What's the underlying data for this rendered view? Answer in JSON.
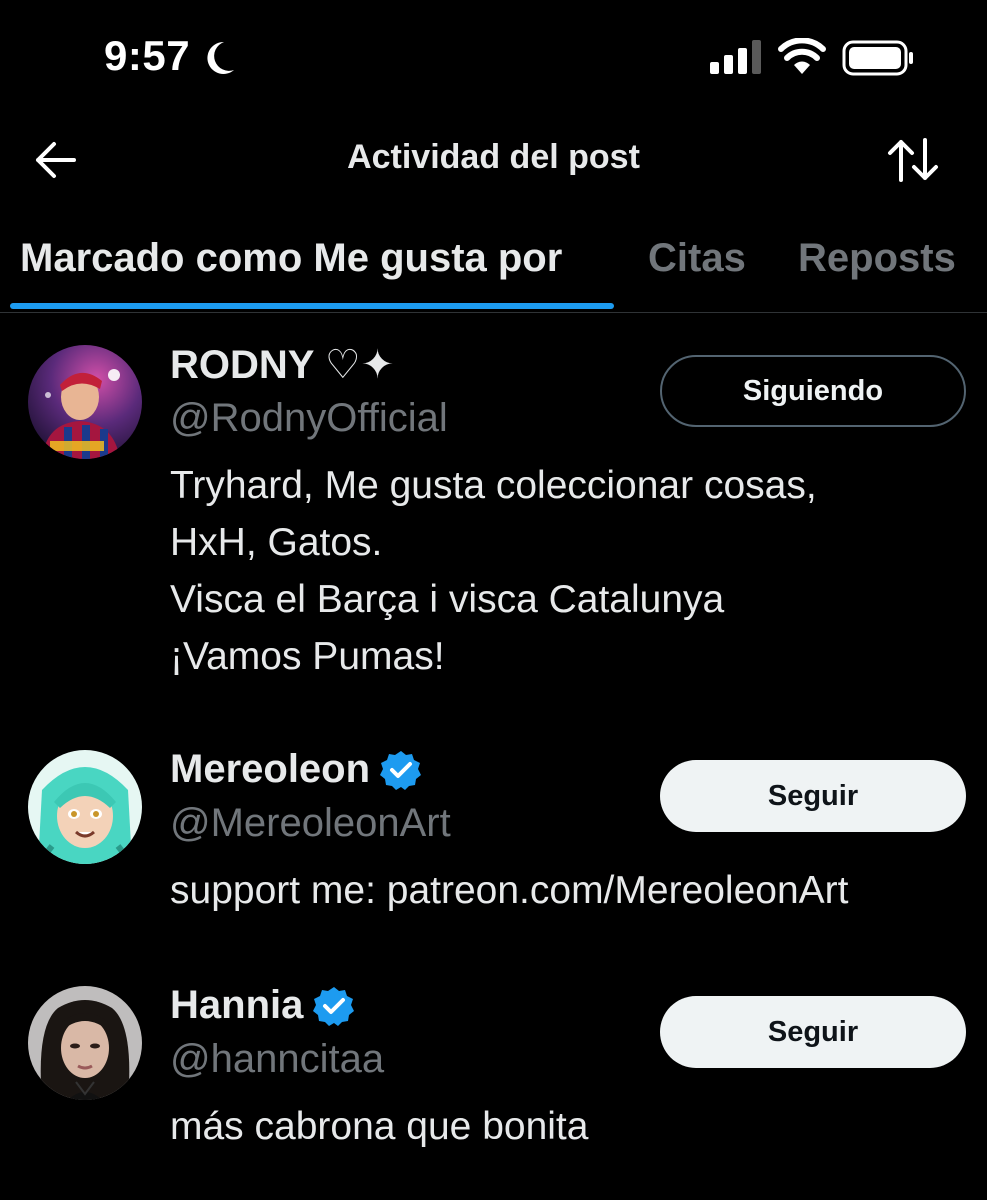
{
  "status_bar": {
    "time": "9:57"
  },
  "header": {
    "title": "Actividad del post"
  },
  "tabs": [
    {
      "label": "Marcado como Me gusta por",
      "active": true
    },
    {
      "label": "Citas",
      "active": false
    },
    {
      "label": "Reposts",
      "active": false
    }
  ],
  "colors": {
    "accent": "#1d9bf0",
    "background": "#000000",
    "secondary_text": "#71767b"
  },
  "users": [
    {
      "name": "RODNY ♡✦",
      "handle": "@RodnyOfficial",
      "verified": false,
      "button": "Siguiendo",
      "bio": [
        "Tryhard, Me gusta coleccionar cosas,",
        "HxH, Gatos.",
        "Visca el Barça i visca Catalunya",
        "¡Vamos Pumas!"
      ]
    },
    {
      "name": "Mereoleon",
      "handle": "@MereoleonArt",
      "verified": true,
      "button": "Seguir",
      "bio": [
        "support me: patreon.com/MereoleonArt"
      ]
    },
    {
      "name": "Hannia",
      "handle": "@hanncitaa",
      "verified": true,
      "button": "Seguir",
      "bio": [
        "más cabrona que bonita"
      ]
    }
  ]
}
